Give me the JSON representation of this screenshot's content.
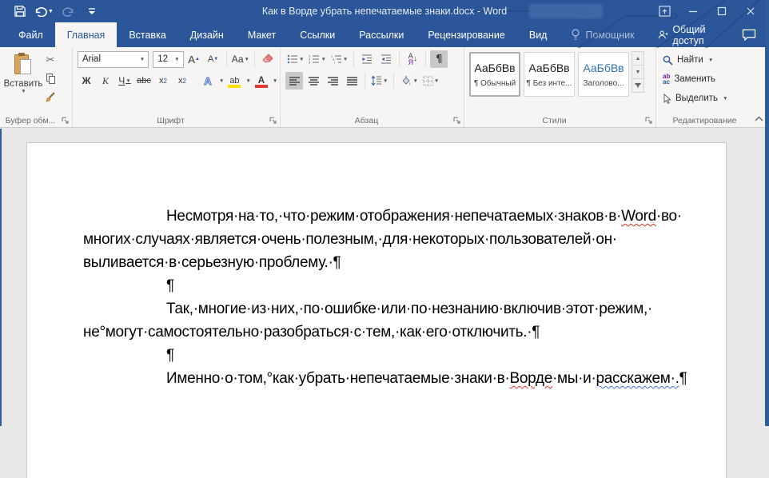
{
  "titlebar": {
    "title": "Как в Ворде убрать непечатаемые знаки.docx - Word"
  },
  "tabs": [
    {
      "label": "Файл",
      "active": false,
      "muted": false
    },
    {
      "label": "Главная",
      "active": true,
      "muted": false
    },
    {
      "label": "Вставка",
      "active": false,
      "muted": false
    },
    {
      "label": "Дизайн",
      "active": false,
      "muted": false
    },
    {
      "label": "Макет",
      "active": false,
      "muted": false
    },
    {
      "label": "Ссылки",
      "active": false,
      "muted": false
    },
    {
      "label": "Рассылки",
      "active": false,
      "muted": false
    },
    {
      "label": "Рецензирование",
      "active": false,
      "muted": false
    },
    {
      "label": "Вид",
      "active": false,
      "muted": false
    },
    {
      "label": "Помощник",
      "active": false,
      "muted": true,
      "icon": "lightbulb-icon"
    }
  ],
  "share_label": "Общий доступ",
  "ribbon": {
    "clipboard": {
      "paste_label": "Вставить",
      "group_label": "Буфер обм..."
    },
    "font": {
      "name": "Arial",
      "size": "12",
      "bold": "Ж",
      "italic": "К",
      "underline": "Ч",
      "strike": "abc",
      "sub_base": "x",
      "sub_digit": "2",
      "sup_base": "x",
      "sup_digit": "2",
      "case_label": "Аа",
      "effects": "А",
      "highlight": "ab",
      "color": "А",
      "grow": "А",
      "shrink": "А",
      "group_label": "Шрифт"
    },
    "paragraph": {
      "sort_a": "А",
      "sort_b": "Я",
      "pilcrow": "¶",
      "group_label": "Абзац"
    },
    "styles": {
      "items": [
        {
          "preview": "АаБбВв",
          "label": "¶ Обычный",
          "selected": true,
          "heading": false
        },
        {
          "preview": "АаБбВв",
          "label": "¶ Без инте...",
          "selected": false,
          "heading": false
        },
        {
          "preview": "АаБбВв",
          "label": "Заголово...",
          "selected": false,
          "heading": true
        }
      ],
      "group_label": "Стили"
    },
    "editing": {
      "find": "Найти",
      "replace": "Заменить",
      "select": "Выделить",
      "group_label": "Редактирование"
    }
  },
  "document": {
    "paragraphs": [
      {
        "indent": true,
        "lines": [
          [
            {
              "t": "Несмотря·на·то,·что·режим·отображения·непечатаемых·знаков·в·"
            },
            {
              "t": "Word",
              "u": "red"
            },
            {
              "t": "·во·"
            }
          ],
          [
            {
              "t": "многих·случаях·является·очень·полезным,·для·некоторых·пользователей·он·"
            }
          ],
          [
            {
              "t": "выливается·в·серьезную·проблему.·¶"
            }
          ]
        ]
      },
      {
        "indent": true,
        "lines": [
          [
            {
              "t": "¶"
            }
          ]
        ]
      },
      {
        "indent": true,
        "lines": [
          [
            {
              "t": "Так,·многие·из·них,·по·ошибке·или·по·незнанию·включив·этот·режим,·"
            }
          ],
          [
            {
              "t": "не°могут·самостоятельно·разобраться·с·тем,·как·его·отключить.·¶"
            }
          ]
        ]
      },
      {
        "indent": true,
        "lines": [
          [
            {
              "t": "¶"
            }
          ]
        ]
      },
      {
        "indent": true,
        "lines": [
          [
            {
              "t": "Именно·о·том,°как·убрать·непечатаемые·знаки·в·"
            },
            {
              "t": "Ворде",
              "u": "red"
            },
            {
              "t": "·мы·и·"
            },
            {
              "t": "расскажем·.",
              "u": "blue"
            },
            {
              "t": "¶"
            }
          ]
        ]
      }
    ]
  },
  "colors": {
    "accent": "#2b579a",
    "squiggle_red": "#d93025",
    "squiggle_blue": "#4169e1",
    "highlight_yellow": "#ffe100",
    "font_color_red": "#e03c31"
  }
}
